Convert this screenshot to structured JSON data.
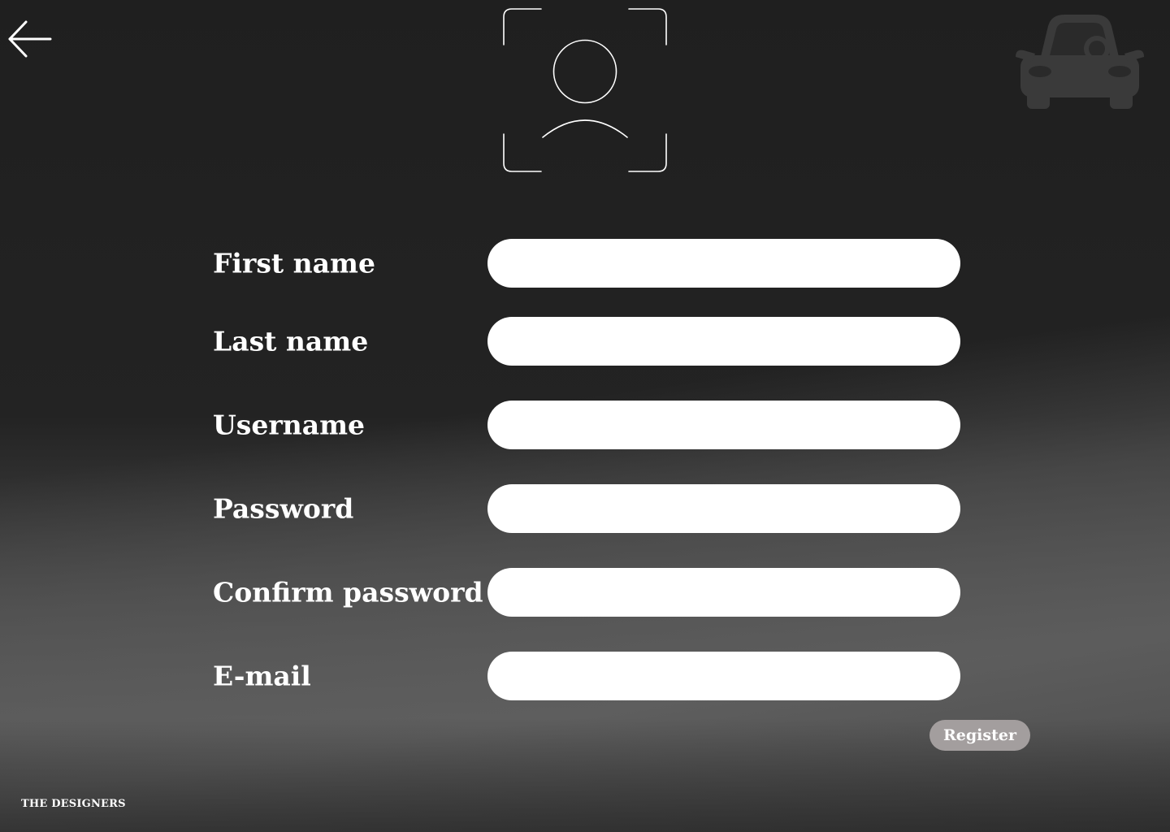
{
  "nav": {
    "back_icon": "arrow-left-icon"
  },
  "header": {
    "avatar_icon": "user-frame-icon",
    "logo_icon": "car-icon"
  },
  "form": {
    "fields": [
      {
        "label": "First name",
        "value": "",
        "placeholder": ""
      },
      {
        "label": "Last name",
        "value": "",
        "placeholder": ""
      },
      {
        "label": "Username",
        "value": "",
        "placeholder": ""
      },
      {
        "label": "Password",
        "value": "",
        "placeholder": ""
      },
      {
        "label": "Confirm password",
        "value": "",
        "placeholder": ""
      },
      {
        "label": "E-mail",
        "value": "",
        "placeholder": ""
      }
    ],
    "submit_label": "Register"
  },
  "footer": {
    "brand": "THE DESIGNERS"
  },
  "colors": {
    "background": "#202020",
    "input_background": "#ffffff",
    "button_background": "#a39e9e",
    "logo": "#3a3a3a"
  }
}
